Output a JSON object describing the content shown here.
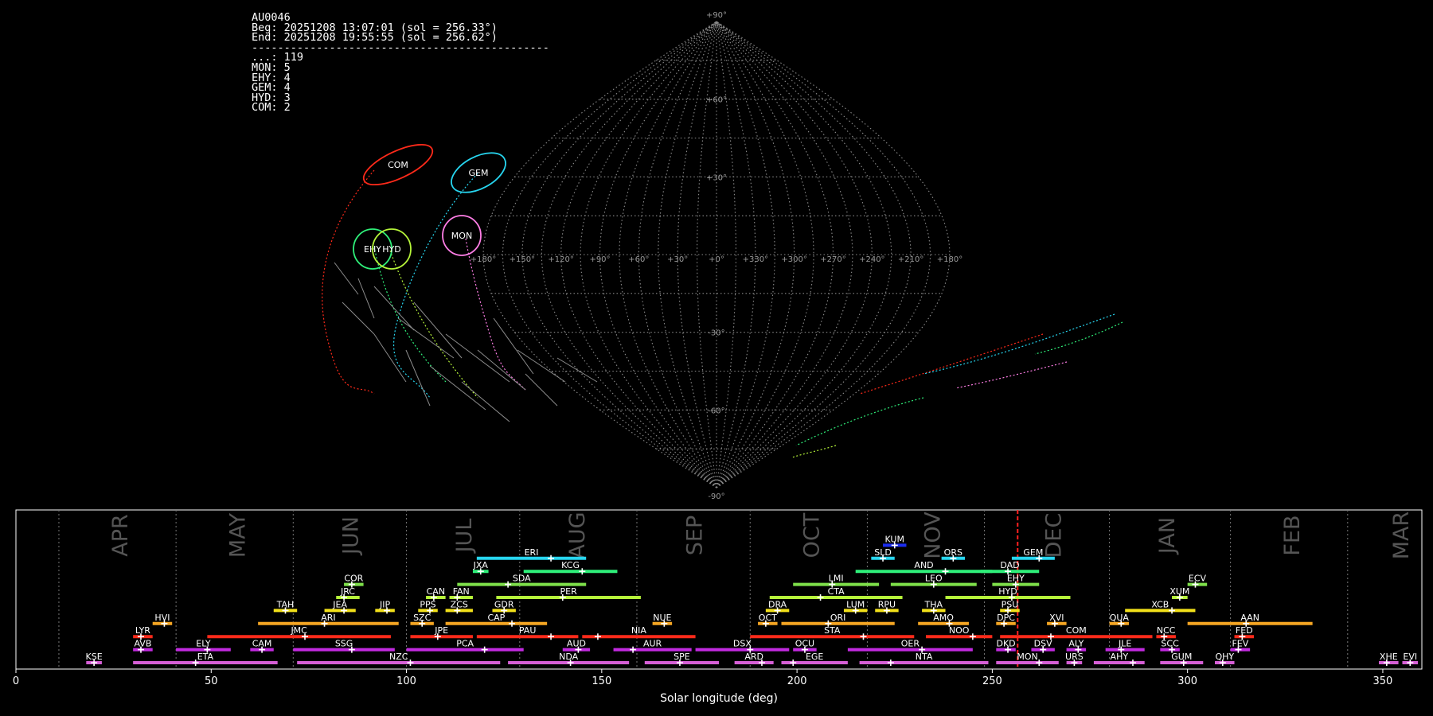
{
  "summary": {
    "station": "AU0046",
    "begin": "Beg: 20251208 13:07:01 (sol = 256.33°)",
    "end": "End: 20251208 19:55:55 (sol = 256.62°)",
    "divider": "----------------------------------------------",
    "counts": [
      {
        "label": "...: 119"
      },
      {
        "label": "MON: 5"
      },
      {
        "label": "EHY: 4"
      },
      {
        "label": "GEM: 4"
      },
      {
        "label": "HYD: 3"
      },
      {
        "label": "COM: 2"
      }
    ]
  },
  "sky_map": {
    "projection": "sinusoidal",
    "lon_labels": [
      "+180°",
      "+150°",
      "+120°",
      "+90°",
      "+60°",
      "+30°",
      "+0°",
      "+330°",
      "+300°",
      "+270°",
      "+240°",
      "+210°",
      "+180°"
    ],
    "lat_labels": [
      "+90°",
      "+60°",
      "+30°",
      "-30°",
      "-60°",
      "-90°"
    ],
    "radiants": [
      {
        "code": "COM",
        "color": "#ff2a1a"
      },
      {
        "code": "GEM",
        "color": "#27d6f0"
      },
      {
        "code": "MON",
        "color": "#ff7ee6"
      },
      {
        "code": "EHY",
        "color": "#2ff07a"
      },
      {
        "code": "HYD",
        "color": "#b6f53a"
      }
    ]
  },
  "chart_data": {
    "type": "timeline",
    "xlabel": "Solar longitude (deg)",
    "xlim": [
      0,
      360
    ],
    "xticks": [
      "0",
      "50",
      "100",
      "150",
      "200",
      "250",
      "300",
      "350"
    ],
    "current_sol": 256.5,
    "months": [
      {
        "name": "APR",
        "sol": 25
      },
      {
        "name": "MAY",
        "sol": 55
      },
      {
        "name": "JUN",
        "sol": 84
      },
      {
        "name": "JUL",
        "sol": 113
      },
      {
        "name": "AUG",
        "sol": 142
      },
      {
        "name": "SEP",
        "sol": 172
      },
      {
        "name": "OCT",
        "sol": 202
      },
      {
        "name": "NOV",
        "sol": 233
      },
      {
        "name": "DEC",
        "sol": 264
      },
      {
        "name": "JAN",
        "sol": 293
      },
      {
        "name": "FEB",
        "sol": 325
      },
      {
        "name": "MAR",
        "sol": 353
      }
    ],
    "month_dividers": [
      11,
      41,
      71,
      100,
      129,
      159,
      188,
      218,
      248,
      280,
      311,
      341
    ],
    "showers": [
      {
        "code": "KUM",
        "start": 222,
        "end": 228,
        "peak": 225,
        "row": 9,
        "color": "#1b2df0"
      },
      {
        "code": "ERI",
        "start": 118,
        "end": 146,
        "peak": 137,
        "row": 8,
        "color": "#27d6f0"
      },
      {
        "code": "SLD",
        "start": 219,
        "end": 225,
        "peak": 222,
        "row": 8,
        "color": "#27d6f0"
      },
      {
        "code": "ORS",
        "start": 237,
        "end": 243,
        "peak": 240,
        "row": 8,
        "color": "#27d6f0"
      },
      {
        "code": "GEM",
        "start": 255,
        "end": 266,
        "peak": 262,
        "row": 8,
        "color": "#27d6f0"
      },
      {
        "code": "JXA",
        "start": 117,
        "end": 121,
        "peak": 119,
        "row": 7,
        "color": "#2ff07a"
      },
      {
        "code": "KCG",
        "start": 130,
        "end": 154,
        "peak": 145,
        "row": 7,
        "color": "#2ff07a"
      },
      {
        "code": "AND",
        "start": 215,
        "end": 250,
        "peak": 238,
        "row": 7,
        "color": "#2ff07a"
      },
      {
        "code": "DAD",
        "start": 247,
        "end": 262,
        "peak": 254,
        "row": 7,
        "color": "#2ff07a"
      },
      {
        "code": "COR",
        "start": 84,
        "end": 89,
        "peak": 86,
        "row": 6,
        "color": "#7ee04a"
      },
      {
        "code": "SDA",
        "start": 113,
        "end": 146,
        "peak": 126,
        "row": 6,
        "color": "#7ee04a"
      },
      {
        "code": "LMI",
        "start": 199,
        "end": 221,
        "peak": 209,
        "row": 6,
        "color": "#7ee04a"
      },
      {
        "code": "LEO",
        "start": 224,
        "end": 246,
        "peak": 235,
        "row": 6,
        "color": "#7ee04a"
      },
      {
        "code": "EHY",
        "start": 250,
        "end": 262,
        "peak": 256,
        "row": 6,
        "color": "#7ee04a"
      },
      {
        "code": "ECV",
        "start": 300,
        "end": 305,
        "peak": 302,
        "row": 6,
        "color": "#7ee04a"
      },
      {
        "code": "JRC",
        "start": 82,
        "end": 88,
        "peak": 84,
        "row": 5,
        "color": "#b6f53a"
      },
      {
        "code": "CAN",
        "start": 105,
        "end": 110,
        "peak": 107,
        "row": 5,
        "color": "#b6f53a"
      },
      {
        "code": "FAN",
        "start": 111,
        "end": 117,
        "peak": 113,
        "row": 5,
        "color": "#b6f53a"
      },
      {
        "code": "PER",
        "start": 123,
        "end": 160,
        "peak": 140,
        "row": 5,
        "color": "#b6f53a"
      },
      {
        "code": "CTA",
        "start": 193,
        "end": 227,
        "peak": 206,
        "row": 5,
        "color": "#b6f53a"
      },
      {
        "code": "HYD",
        "start": 238,
        "end": 270,
        "peak": 255,
        "row": 5,
        "color": "#b6f53a"
      },
      {
        "code": "XUM",
        "start": 296,
        "end": 300,
        "peak": 298,
        "row": 5,
        "color": "#b6f53a"
      },
      {
        "code": "TAH",
        "start": 66,
        "end": 72,
        "peak": 69,
        "row": 4,
        "color": "#f2e01a"
      },
      {
        "code": "JEA",
        "start": 79,
        "end": 87,
        "peak": 84,
        "row": 4,
        "color": "#f2e01a"
      },
      {
        "code": "JIP",
        "start": 92,
        "end": 97,
        "peak": 95,
        "row": 4,
        "color": "#f2e01a"
      },
      {
        "code": "PPS",
        "start": 103,
        "end": 108,
        "peak": 106,
        "row": 4,
        "color": "#f2e01a"
      },
      {
        "code": "ZCS",
        "start": 110,
        "end": 117,
        "peak": 113,
        "row": 4,
        "color": "#f2e01a"
      },
      {
        "code": "GDR",
        "start": 122,
        "end": 128,
        "peak": 125,
        "row": 4,
        "color": "#f2e01a"
      },
      {
        "code": "DRA",
        "start": 192,
        "end": 198,
        "peak": 195,
        "row": 4,
        "color": "#f2e01a"
      },
      {
        "code": "LUM",
        "start": 212,
        "end": 218,
        "peak": 215,
        "row": 4,
        "color": "#f2e01a"
      },
      {
        "code": "RPU",
        "start": 220,
        "end": 226,
        "peak": 223,
        "row": 4,
        "color": "#f2e01a"
      },
      {
        "code": "THA",
        "start": 232,
        "end": 238,
        "peak": 235,
        "row": 4,
        "color": "#f2e01a"
      },
      {
        "code": "PSU",
        "start": 252,
        "end": 257,
        "peak": 254,
        "row": 4,
        "color": "#f2e01a"
      },
      {
        "code": "XCB",
        "start": 284,
        "end": 302,
        "peak": 296,
        "row": 4,
        "color": "#f2e01a"
      },
      {
        "code": "HVI",
        "start": 35,
        "end": 40,
        "peak": 38,
        "row": 3,
        "color": "#f5a623"
      },
      {
        "code": "ARI",
        "start": 62,
        "end": 98,
        "peak": 79,
        "row": 3,
        "color": "#f5a623"
      },
      {
        "code": "SZC",
        "start": 101,
        "end": 107,
        "peak": 104,
        "row": 3,
        "color": "#f5a623"
      },
      {
        "code": "CAP",
        "start": 110,
        "end": 136,
        "peak": 127,
        "row": 3,
        "color": "#f5a623"
      },
      {
        "code": "NUE",
        "start": 163,
        "end": 168,
        "peak": 166,
        "row": 3,
        "color": "#f5a623"
      },
      {
        "code": "OCT",
        "start": 190,
        "end": 195,
        "peak": 192,
        "row": 3,
        "color": "#f5a623"
      },
      {
        "code": "ORI",
        "start": 196,
        "end": 225,
        "peak": 208,
        "row": 3,
        "color": "#f5a623"
      },
      {
        "code": "AMO",
        "start": 231,
        "end": 244,
        "peak": 239,
        "row": 3,
        "color": "#f5a623"
      },
      {
        "code": "DPC",
        "start": 251,
        "end": 256,
        "peak": 253,
        "row": 3,
        "color": "#f5a623"
      },
      {
        "code": "XVI",
        "start": 264,
        "end": 269,
        "peak": 266,
        "row": 3,
        "color": "#f5a623"
      },
      {
        "code": "QUA",
        "start": 280,
        "end": 285,
        "peak": 283,
        "row": 3,
        "color": "#f5a623"
      },
      {
        "code": "AAN",
        "start": 300,
        "end": 332,
        "peak": 315,
        "row": 3,
        "color": "#f5a623"
      },
      {
        "code": "LYR",
        "start": 30,
        "end": 35,
        "peak": 32,
        "row": 2,
        "color": "#ff2a1a"
      },
      {
        "code": "JMC",
        "start": 49,
        "end": 96,
        "peak": 74,
        "row": 2,
        "color": "#ff2a1a"
      },
      {
        "code": "JPE",
        "start": 101,
        "end": 117,
        "peak": 108,
        "row": 2,
        "color": "#ff2a1a"
      },
      {
        "code": "PAU",
        "start": 118,
        "end": 144,
        "peak": 137,
        "row": 2,
        "color": "#ff2a1a"
      },
      {
        "code": "NIA",
        "start": 145,
        "end": 174,
        "peak": 149,
        "row": 2,
        "color": "#ff2a1a"
      },
      {
        "code": "STA",
        "start": 188,
        "end": 230,
        "peak": 217,
        "row": 2,
        "color": "#ff2a1a"
      },
      {
        "code": "NOO",
        "start": 233,
        "end": 250,
        "peak": 245,
        "row": 2,
        "color": "#ff2a1a"
      },
      {
        "code": "COM",
        "start": 252,
        "end": 291,
        "peak": 265,
        "row": 2,
        "color": "#ff2a1a"
      },
      {
        "code": "NCC",
        "start": 292,
        "end": 297,
        "peak": 294,
        "row": 2,
        "color": "#ff2a1a"
      },
      {
        "code": "FED",
        "start": 312,
        "end": 317,
        "peak": 314,
        "row": 2,
        "color": "#ff2a1a"
      },
      {
        "code": "AVB",
        "start": 30,
        "end": 35,
        "peak": 32,
        "row": 1,
        "color": "#c22ae0"
      },
      {
        "code": "ELY",
        "start": 41,
        "end": 55,
        "peak": 49,
        "row": 1,
        "color": "#c22ae0"
      },
      {
        "code": "CAM",
        "start": 60,
        "end": 66,
        "peak": 63,
        "row": 1,
        "color": "#c22ae0"
      },
      {
        "code": "SSG",
        "start": 71,
        "end": 97,
        "peak": 86,
        "row": 1,
        "color": "#c22ae0"
      },
      {
        "code": "PCA",
        "start": 100,
        "end": 130,
        "peak": 120,
        "row": 1,
        "color": "#c22ae0"
      },
      {
        "code": "AUD",
        "start": 140,
        "end": 147,
        "peak": 144,
        "row": 1,
        "color": "#c22ae0"
      },
      {
        "code": "AUR",
        "start": 153,
        "end": 173,
        "peak": 158,
        "row": 1,
        "color": "#c22ae0"
      },
      {
        "code": "DSX",
        "start": 174,
        "end": 198,
        "peak": 188,
        "row": 1,
        "color": "#c22ae0"
      },
      {
        "code": "OCU",
        "start": 199,
        "end": 205,
        "peak": 202,
        "row": 1,
        "color": "#c22ae0"
      },
      {
        "code": "OER",
        "start": 213,
        "end": 245,
        "peak": 232,
        "row": 1,
        "color": "#c22ae0"
      },
      {
        "code": "DKD",
        "start": 251,
        "end": 256,
        "peak": 254,
        "row": 1,
        "color": "#c22ae0"
      },
      {
        "code": "DSV",
        "start": 260,
        "end": 266,
        "peak": 263,
        "row": 1,
        "color": "#c22ae0"
      },
      {
        "code": "ALY",
        "start": 269,
        "end": 274,
        "peak": 272,
        "row": 1,
        "color": "#c22ae0"
      },
      {
        "code": "JLE",
        "start": 279,
        "end": 289,
        "peak": 283,
        "row": 1,
        "color": "#c22ae0"
      },
      {
        "code": "SCC",
        "start": 293,
        "end": 298,
        "peak": 296,
        "row": 1,
        "color": "#c22ae0"
      },
      {
        "code": "FEV",
        "start": 311,
        "end": 316,
        "peak": 313,
        "row": 1,
        "color": "#c22ae0"
      },
      {
        "code": "KSE",
        "start": 18,
        "end": 22,
        "peak": 20,
        "row": 0,
        "color": "#d65fd6"
      },
      {
        "code": "ETA",
        "start": 30,
        "end": 67,
        "peak": 46,
        "row": 0,
        "color": "#d65fd6"
      },
      {
        "code": "NZC",
        "start": 72,
        "end": 124,
        "peak": 101,
        "row": 0,
        "color": "#d65fd6"
      },
      {
        "code": "NDA",
        "start": 126,
        "end": 157,
        "peak": 142,
        "row": 0,
        "color": "#d65fd6"
      },
      {
        "code": "SPE",
        "start": 161,
        "end": 180,
        "peak": 170,
        "row": 0,
        "color": "#d65fd6"
      },
      {
        "code": "ARD",
        "start": 184,
        "end": 194,
        "peak": 191,
        "row": 0,
        "color": "#d65fd6"
      },
      {
        "code": "EGE",
        "start": 196,
        "end": 213,
        "peak": 199,
        "row": 0,
        "color": "#d65fd6"
      },
      {
        "code": "NTA",
        "start": 216,
        "end": 249,
        "peak": 224,
        "row": 0,
        "color": "#d65fd6"
      },
      {
        "code": "MON",
        "start": 251,
        "end": 267,
        "peak": 262,
        "row": 0,
        "color": "#d65fd6"
      },
      {
        "code": "URS",
        "start": 269,
        "end": 273,
        "peak": 271,
        "row": 0,
        "color": "#d65fd6"
      },
      {
        "code": "AHY",
        "start": 276,
        "end": 289,
        "peak": 286,
        "row": 0,
        "color": "#d65fd6"
      },
      {
        "code": "GUM",
        "start": 293,
        "end": 304,
        "peak": 299,
        "row": 0,
        "color": "#d65fd6"
      },
      {
        "code": "QHY",
        "start": 307,
        "end": 312,
        "peak": 309,
        "row": 0,
        "color": "#d65fd6"
      },
      {
        "code": "XHE",
        "start": 349,
        "end": 354,
        "peak": 351,
        "row": 0,
        "color": "#d65fd6"
      },
      {
        "code": "EVI",
        "start": 355,
        "end": 359,
        "peak": 357,
        "row": 0,
        "color": "#d65fd6"
      }
    ]
  }
}
